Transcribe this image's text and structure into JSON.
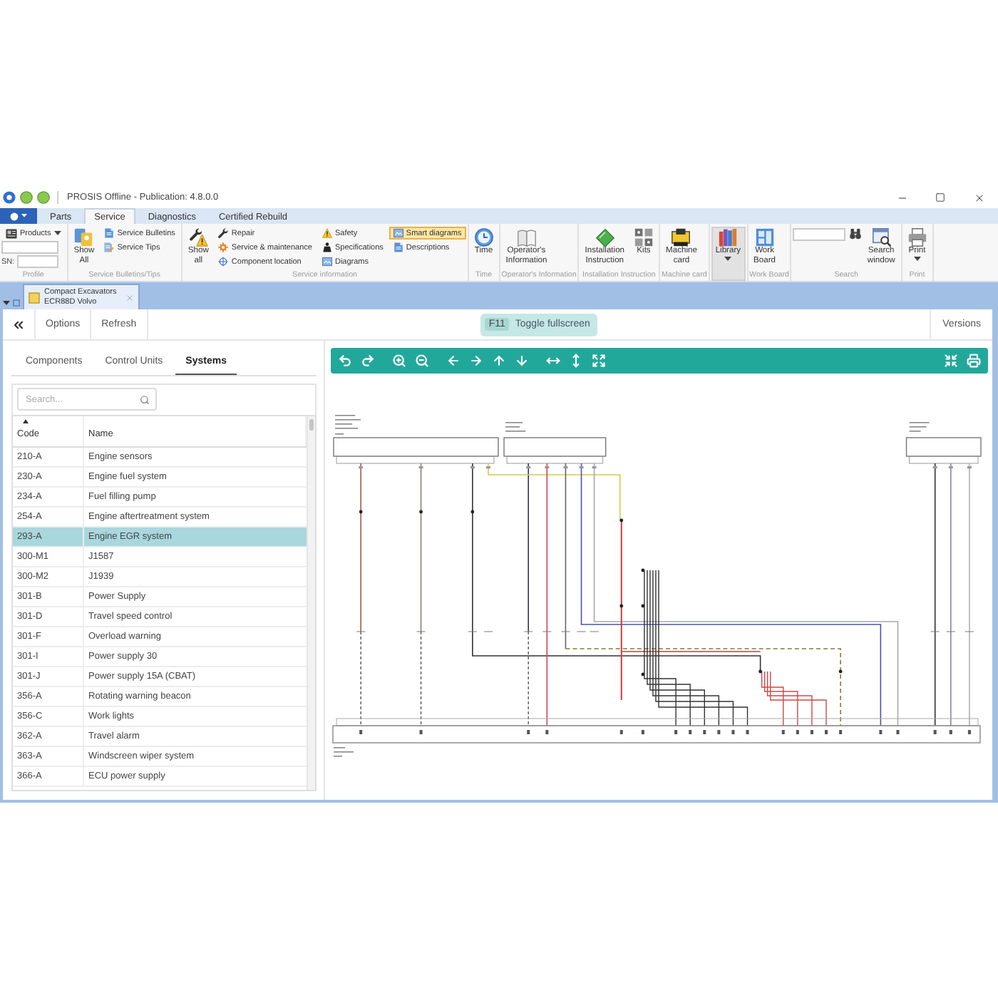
{
  "window": {
    "title": "PROSIS Offline - Publication: 4.8.0.0"
  },
  "ribbon": {
    "tabs": [
      {
        "label": "Parts",
        "selected": false
      },
      {
        "label": "Service",
        "selected": true
      },
      {
        "label": "Diagnostics",
        "selected": false
      },
      {
        "label": "Certified Rebuild",
        "selected": false
      }
    ],
    "groups": [
      {
        "label": "Profile",
        "columns": [
          {
            "kind": "profile",
            "dropdown": "Products",
            "sn_label": "SN:"
          }
        ]
      },
      {
        "label": "Service Bulletins/Tips",
        "columns": [
          {
            "kind": "large",
            "label": "Show All",
            "hovered": false,
            "dropdown": false
          },
          {
            "kind": "stack",
            "items": [
              {
                "label": "Service Bulletins",
                "checked": false
              },
              {
                "label": "Service Tips",
                "checked": false
              }
            ]
          }
        ]
      },
      {
        "label": "Service information",
        "columns": [
          {
            "kind": "large",
            "label": "Show all",
            "hovered": false,
            "dropdown": false
          },
          {
            "kind": "stack",
            "items": [
              {
                "label": "Repair",
                "checked": false
              },
              {
                "label": "Service & maintenance",
                "checked": false
              },
              {
                "label": "Component location",
                "checked": false
              }
            ]
          },
          {
            "kind": "stack",
            "items": [
              {
                "label": "Safety",
                "checked": false
              },
              {
                "label": "Specifications",
                "checked": false
              },
              {
                "label": "Diagrams",
                "checked": false
              }
            ]
          },
          {
            "kind": "stack",
            "items": [
              {
                "label": "Smart diagrams",
                "checked": true
              },
              {
                "label": "Descriptions",
                "checked": false
              }
            ]
          }
        ]
      },
      {
        "label": "Time",
        "columns": [
          {
            "kind": "large",
            "label": "Time",
            "hovered": false,
            "dropdown": false
          }
        ]
      },
      {
        "label": "Operator's Information",
        "columns": [
          {
            "kind": "large",
            "label": "Operator's Information",
            "hovered": false,
            "dropdown": false
          }
        ]
      },
      {
        "label": "Installation Instruction",
        "columns": [
          {
            "kind": "large",
            "label": "Installation Instruction",
            "hovered": false,
            "dropdown": false
          },
          {
            "kind": "large",
            "label": "Kits",
            "hovered": false,
            "dropdown": false
          }
        ]
      },
      {
        "label": "Machine card",
        "columns": [
          {
            "kind": "large",
            "label": "Machine card",
            "hovered": false,
            "dropdown": false
          }
        ]
      },
      {
        "columns": [
          {
            "kind": "large",
            "label": "Library",
            "hovered": true,
            "dropdown": true
          }
        ]
      },
      {
        "label": "Work Board",
        "columns": [
          {
            "kind": "large",
            "label": "Work Board",
            "hovered": false,
            "dropdown": false
          }
        ]
      },
      {
        "label": "Search",
        "columns": [
          {
            "kind": "search"
          },
          {
            "kind": "large",
            "label": "Search window",
            "hovered": false,
            "dropdown": false
          }
        ]
      },
      {
        "label": "Print",
        "columns": [
          {
            "kind": "large",
            "label": "Print",
            "hovered": false,
            "dropdown": true
          }
        ]
      }
    ]
  },
  "document_tabs": [
    {
      "title": "Compact Excavators",
      "subtitle": "ECR88D Volvo",
      "selected": true
    }
  ],
  "toolbar": {
    "options": "Options",
    "refresh": "Refresh",
    "fullscreen_key": "F11",
    "fullscreen_label": "Toggle fullscreen",
    "versions": "Versions"
  },
  "panel_tabs": [
    {
      "label": "Components",
      "selected": false
    },
    {
      "label": "Control Units",
      "selected": false
    },
    {
      "label": "Systems",
      "selected": true
    }
  ],
  "search": {
    "placeholder": "Search..."
  },
  "table": {
    "columns": [
      {
        "label": "Code",
        "sorted": true
      },
      {
        "label": "Name",
        "sorted": false
      }
    ],
    "rows": [
      {
        "code": "210-A",
        "name": "Engine sensors",
        "selected": false
      },
      {
        "code": "230-A",
        "name": "Engine fuel system",
        "selected": false
      },
      {
        "code": "234-A",
        "name": "Fuel filling pump",
        "selected": false
      },
      {
        "code": "254-A",
        "name": "Engine aftertreatment system",
        "selected": false
      },
      {
        "code": "293-A",
        "name": "Engine EGR system",
        "selected": true
      },
      {
        "code": "300-M1",
        "name": "J1587",
        "selected": false
      },
      {
        "code": "300-M2",
        "name": "J1939",
        "selected": false
      },
      {
        "code": "301-B",
        "name": "Power Supply",
        "selected": false
      },
      {
        "code": "301-D",
        "name": "Travel speed control",
        "selected": false
      },
      {
        "code": "301-F",
        "name": "Overload warning",
        "selected": false
      },
      {
        "code": "301-I",
        "name": "Power supply 30",
        "selected": false
      },
      {
        "code": "301-J",
        "name": "Power supply 15A (CBAT)",
        "selected": false
      },
      {
        "code": "356-A",
        "name": "Rotating warning beacon",
        "selected": false
      },
      {
        "code": "356-C",
        "name": "Work lights",
        "selected": false
      },
      {
        "code": "362-A",
        "name": "Travel alarm",
        "selected": false
      },
      {
        "code": "363-A",
        "name": "Windscreen wiper system",
        "selected": false
      },
      {
        "code": "366-A",
        "name": "ECU power supply",
        "selected": false
      }
    ]
  }
}
